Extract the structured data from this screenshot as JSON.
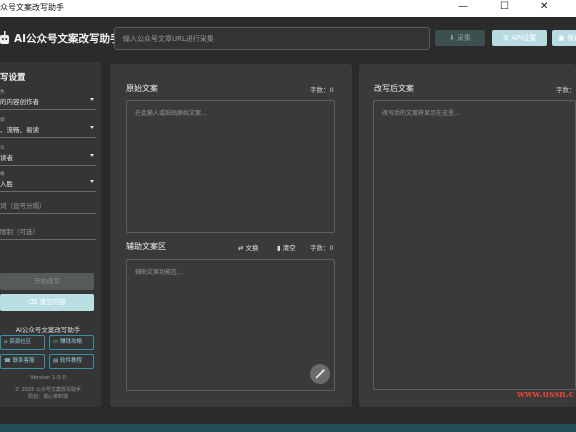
{
  "window": {
    "title": "众号文案改写助手"
  },
  "header": {
    "app_title": "AI公众号文案改写助手",
    "url_placeholder": "输入公众号文章URL进行采集",
    "collect_label": "采集",
    "api_label": "API设置",
    "save_label": "保存"
  },
  "sidebar": {
    "title": "写设置",
    "selects": [
      {
        "label": "色",
        "value": "的内容创作者"
      },
      {
        "label": "调",
        "value": "、流畅、易读"
      },
      {
        "label": "众",
        "value": "读者"
      },
      {
        "label": "格",
        "value": "入胜"
      }
    ],
    "keywords_placeholder": "词（逗号分隔）",
    "extra_placeholder": "限制（可选）",
    "start_label": "开始改写",
    "clear_label": "清空内容",
    "brand": "AI公众号文案改写助手",
    "links": [
      "资源社区",
      "赚钱攻略",
      "联系客服",
      "软件教程"
    ],
    "version": "Version 1.0.0",
    "copyright_line1": "© 2025 公众号文案改写助手",
    "copyright_line2": "原创：漫心资料馆"
  },
  "original": {
    "title": "原始文案",
    "count": "字数：0",
    "placeholder": "在此输入或粘贴原始文案..."
  },
  "assist": {
    "title": "辅助文案区",
    "swap_label": "文换",
    "clear_label": "清空",
    "count": "字数：0",
    "placeholder": "辅助文案功能区..."
  },
  "rewritten": {
    "title": "改写后文案",
    "count": "字数：",
    "placeholder": "改写后的文案将显示在这里..."
  },
  "watermark": "www.ussn.c",
  "colors": {
    "accent": "#b9dfe3",
    "panel": "#3a3a3a",
    "background": "#2a2a2a"
  }
}
